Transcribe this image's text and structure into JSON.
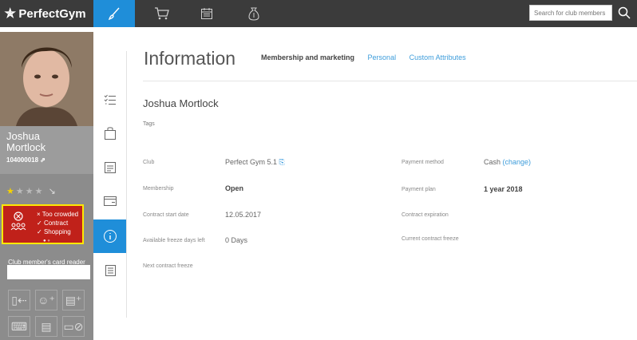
{
  "brand": "PerfectGym",
  "topbar": {
    "search_placeholder": "Search for club members",
    "tabs": [
      "brush-icon",
      "cart-icon",
      "calendar-icon",
      "money-bag-icon"
    ]
  },
  "member": {
    "first_name": "Joshua",
    "last_name": "Mortlock",
    "id": "104000018",
    "rating_filled": 1,
    "rating_total": 4
  },
  "alerts": [
    "Too crowded",
    "Contract",
    "Shopping"
  ],
  "card_reader": {
    "label": "Club member's card reader",
    "value": ""
  },
  "page": {
    "title": "Information",
    "tabs": [
      "Membership and marketing",
      "Personal",
      "Custom Attributes"
    ],
    "active_tab": "Membership and marketing",
    "full_name": "Joshua Mortlock",
    "tags_label": "Tags"
  },
  "fields": {
    "club_label": "Club",
    "club_value": "Perfect Gym 5.1",
    "membership_label": "Membership",
    "membership_value": "Open",
    "contract_start_label": "Contract start date",
    "contract_start_value": "12.05.2017",
    "freeze_days_label": "Available freeze days left",
    "freeze_days_value": "0 Days",
    "next_freeze_label": "Next contract freeze",
    "payment_method_label": "Payment method",
    "payment_method_value": "Cash",
    "payment_method_change": "(change)",
    "payment_plan_label": "Payment plan",
    "payment_plan_value": "1 year 2018",
    "contract_expiration_label": "Contract expiration",
    "current_freeze_label": "Current contract freeze"
  },
  "colors": {
    "accent": "#1f8ed9",
    "topbar": "#3b3b3b",
    "alert": "#c0211a",
    "alert_border": "#ffe800"
  }
}
